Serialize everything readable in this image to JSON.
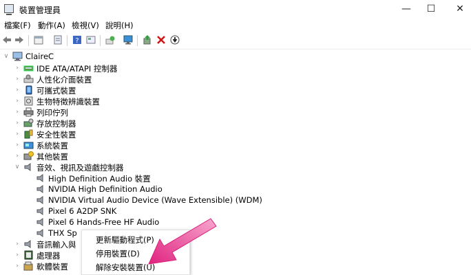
{
  "window": {
    "title": "裝置管理員"
  },
  "menu": [
    "檔案(F)",
    "動作(A)",
    "檢視(V)",
    "說明(H)"
  ],
  "toolbar_icons": [
    "back-icon",
    "forward-icon",
    "properties-icon",
    "view-icon",
    "help-icon",
    "resources-icon",
    "scan-hardware-icon",
    "monitor-icon",
    "update-driver-icon",
    "uninstall-icon",
    "disable-icon"
  ],
  "tree": {
    "root": "ClaireC",
    "categories": [
      "IDE ATA/ATAPI 控制器",
      "人性化介面裝置",
      "可攜式裝置",
      "生物特徵辨識裝置",
      "列印佇列",
      "存放控制器",
      "安全性裝置",
      "系統裝置",
      "其他裝置",
      "音效、視訊及遊戲控制器"
    ],
    "audio_devices": [
      "High Definition Audio 裝置",
      "NVIDIA High Definition Audio",
      "NVIDIA Virtual Audio Device (Wave Extensible) (WDM)",
      "Pixel 6 A2DP SNK",
      "Pixel 6 Hands-Free HF Audio",
      "THX Sp"
    ],
    "after": [
      "音訊輸入與",
      "處理器",
      "軟體裝置"
    ]
  },
  "context_menu": [
    "更新驅動程式(P)",
    "停用裝置(D)",
    "解除安裝裝置(U)"
  ],
  "colors": {
    "arrow": "#e8308a",
    "accent": "#0a64c8"
  }
}
